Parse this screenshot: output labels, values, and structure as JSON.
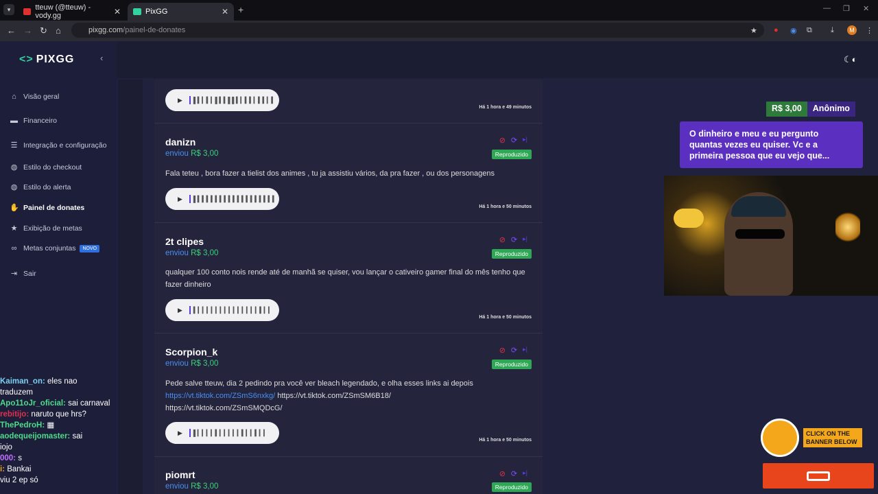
{
  "browser": {
    "tabs": [
      {
        "title": "tteuw (@tteuw) - vody.gg"
      },
      {
        "title": "PixGG"
      }
    ],
    "url_host": "pixgg.com",
    "url_path": "/painel-de-donates",
    "profile_initial": "M"
  },
  "sidebar": {
    "logo": "PIXGG",
    "items": [
      {
        "label": "Visão geral",
        "icon": "home"
      },
      {
        "label": "Financeiro",
        "icon": "wallet"
      },
      {
        "label": "Integração e configuração",
        "icon": "doc"
      },
      {
        "label": "Estilo do checkout",
        "icon": "palette"
      },
      {
        "label": "Estilo do alerta",
        "icon": "palette"
      },
      {
        "label": "Painel de donates",
        "icon": "hand"
      },
      {
        "label": "Exibição de metas",
        "icon": "star"
      },
      {
        "label": "Metas conjuntas",
        "icon": "link",
        "badge": "NOVO"
      },
      {
        "label": "Sair",
        "icon": "logout"
      }
    ]
  },
  "chat": [
    {
      "user": "Kaiman_on:",
      "text": "eles nao",
      "color": "#7ad0f0"
    },
    {
      "user": "",
      "text": "traduzem",
      "color": "#ffffff"
    },
    {
      "user": "Apo11oJr_oficial:",
      "text": "sai carnaval",
      "color": "#4ddc8a"
    },
    {
      "user": "rebitijo:",
      "text": "naruto que hrs?",
      "color": "#e03050"
    },
    {
      "user": "ThePedroH:",
      "text": "▦",
      "color": "#4ddc8a"
    },
    {
      "user": "aodequeijomaster:",
      "text": "sai",
      "color": "#4ddc8a"
    },
    {
      "user": "",
      "text": "iojo",
      "color": "#ffffff"
    },
    {
      "user": "000:",
      "text": "s",
      "color": "#c070ff"
    },
    {
      "user": "i:",
      "text": "Bankai",
      "color": "#e0a020"
    },
    {
      "user": "",
      "text": "viu 2 ep só",
      "color": "#ffffff"
    }
  ],
  "donations": [
    {
      "name": "",
      "sent_label": "",
      "amount": "",
      "message": "",
      "time": "Há 1 hora e 49 minutos",
      "status": ""
    },
    {
      "name": "danizn",
      "sent_label": "enviou",
      "amount": "R$ 3,00",
      "message": "Fala teteu , bora fazer a tielist dos animes , tu ja assistiu vários, da pra fazer , ou dos personagens",
      "time": "Há 1 hora e 50 minutos",
      "status": "Reproduzido"
    },
    {
      "name": "2t clipes",
      "sent_label": "enviou",
      "amount": "R$ 3,00",
      "message": "qualquer 100 conto nois rende até de manhã se quiser, vou lançar o cativeiro gamer final do mês tenho que fazer dinheiro",
      "time": "Há 1 hora e 50 minutos",
      "status": "Reproduzido"
    },
    {
      "name": "Scorpion_k",
      "sent_label": "enviou",
      "amount": "R$ 3,00",
      "message_pre": "Pede salve tteuw, dia 2 pedindo pra você ver bleach legendado, e olha esses links ai depois",
      "link1": "https://vt.tiktok.com/ZSmS6nxkg/",
      "link2": "https://vt.tiktok.com/ZSmSM6B18/",
      "link3": "https://vt.tiktok.com/ZSmSMQDcG/",
      "time": "Há 1 hora e 50 minutos",
      "status": "Reproduzido"
    },
    {
      "name": "piomrt",
      "sent_label": "enviou",
      "amount": "R$ 3,00",
      "status": "Reproduzido"
    }
  ],
  "overlay": {
    "amount": "R$ 3,00",
    "donor": "Anônimo",
    "message": "O dinheiro e meu e eu pergunto quantas vezes eu quiser. Vc e a primeira pessoa que eu vejo que..."
  },
  "banner": {
    "text": "CLICK ON THE BANNER BELOW"
  },
  "colors": {
    "accent": "#5b2fc0",
    "money": "#3ad27a",
    "link": "#4a8ef0",
    "status": "#2fa855"
  }
}
